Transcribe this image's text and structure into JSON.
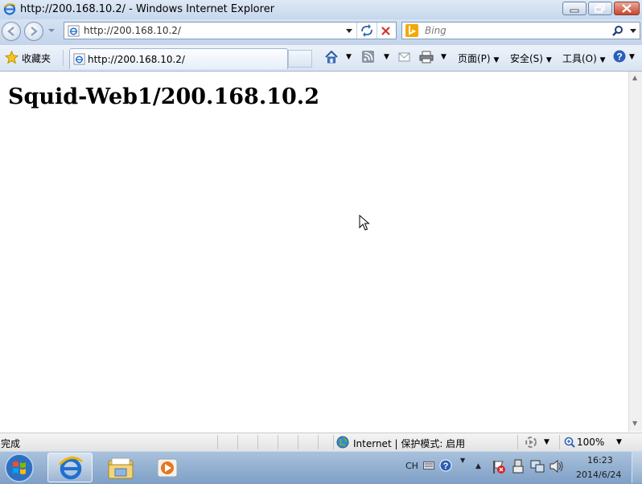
{
  "window": {
    "title": "http://200.168.10.2/ - Windows Internet Explorer"
  },
  "address_bar": {
    "url": "http://200.168.10.2/"
  },
  "search": {
    "placeholder": "Bing"
  },
  "favorites": {
    "label": "收藏夹"
  },
  "tab": {
    "title": "http://200.168.10.2/"
  },
  "command_bar": {
    "page": "页面(P)",
    "safety": "安全(S)",
    "tools": "工具(O)"
  },
  "content": {
    "heading": "Squid-Web1/200.168.10.2"
  },
  "status_bar": {
    "status": "完成",
    "zone": "Internet | 保护模式: 启用",
    "zoom": "100%"
  },
  "taskbar": {
    "ime": "CH",
    "time": "16:23",
    "date": "2014/6/24"
  }
}
